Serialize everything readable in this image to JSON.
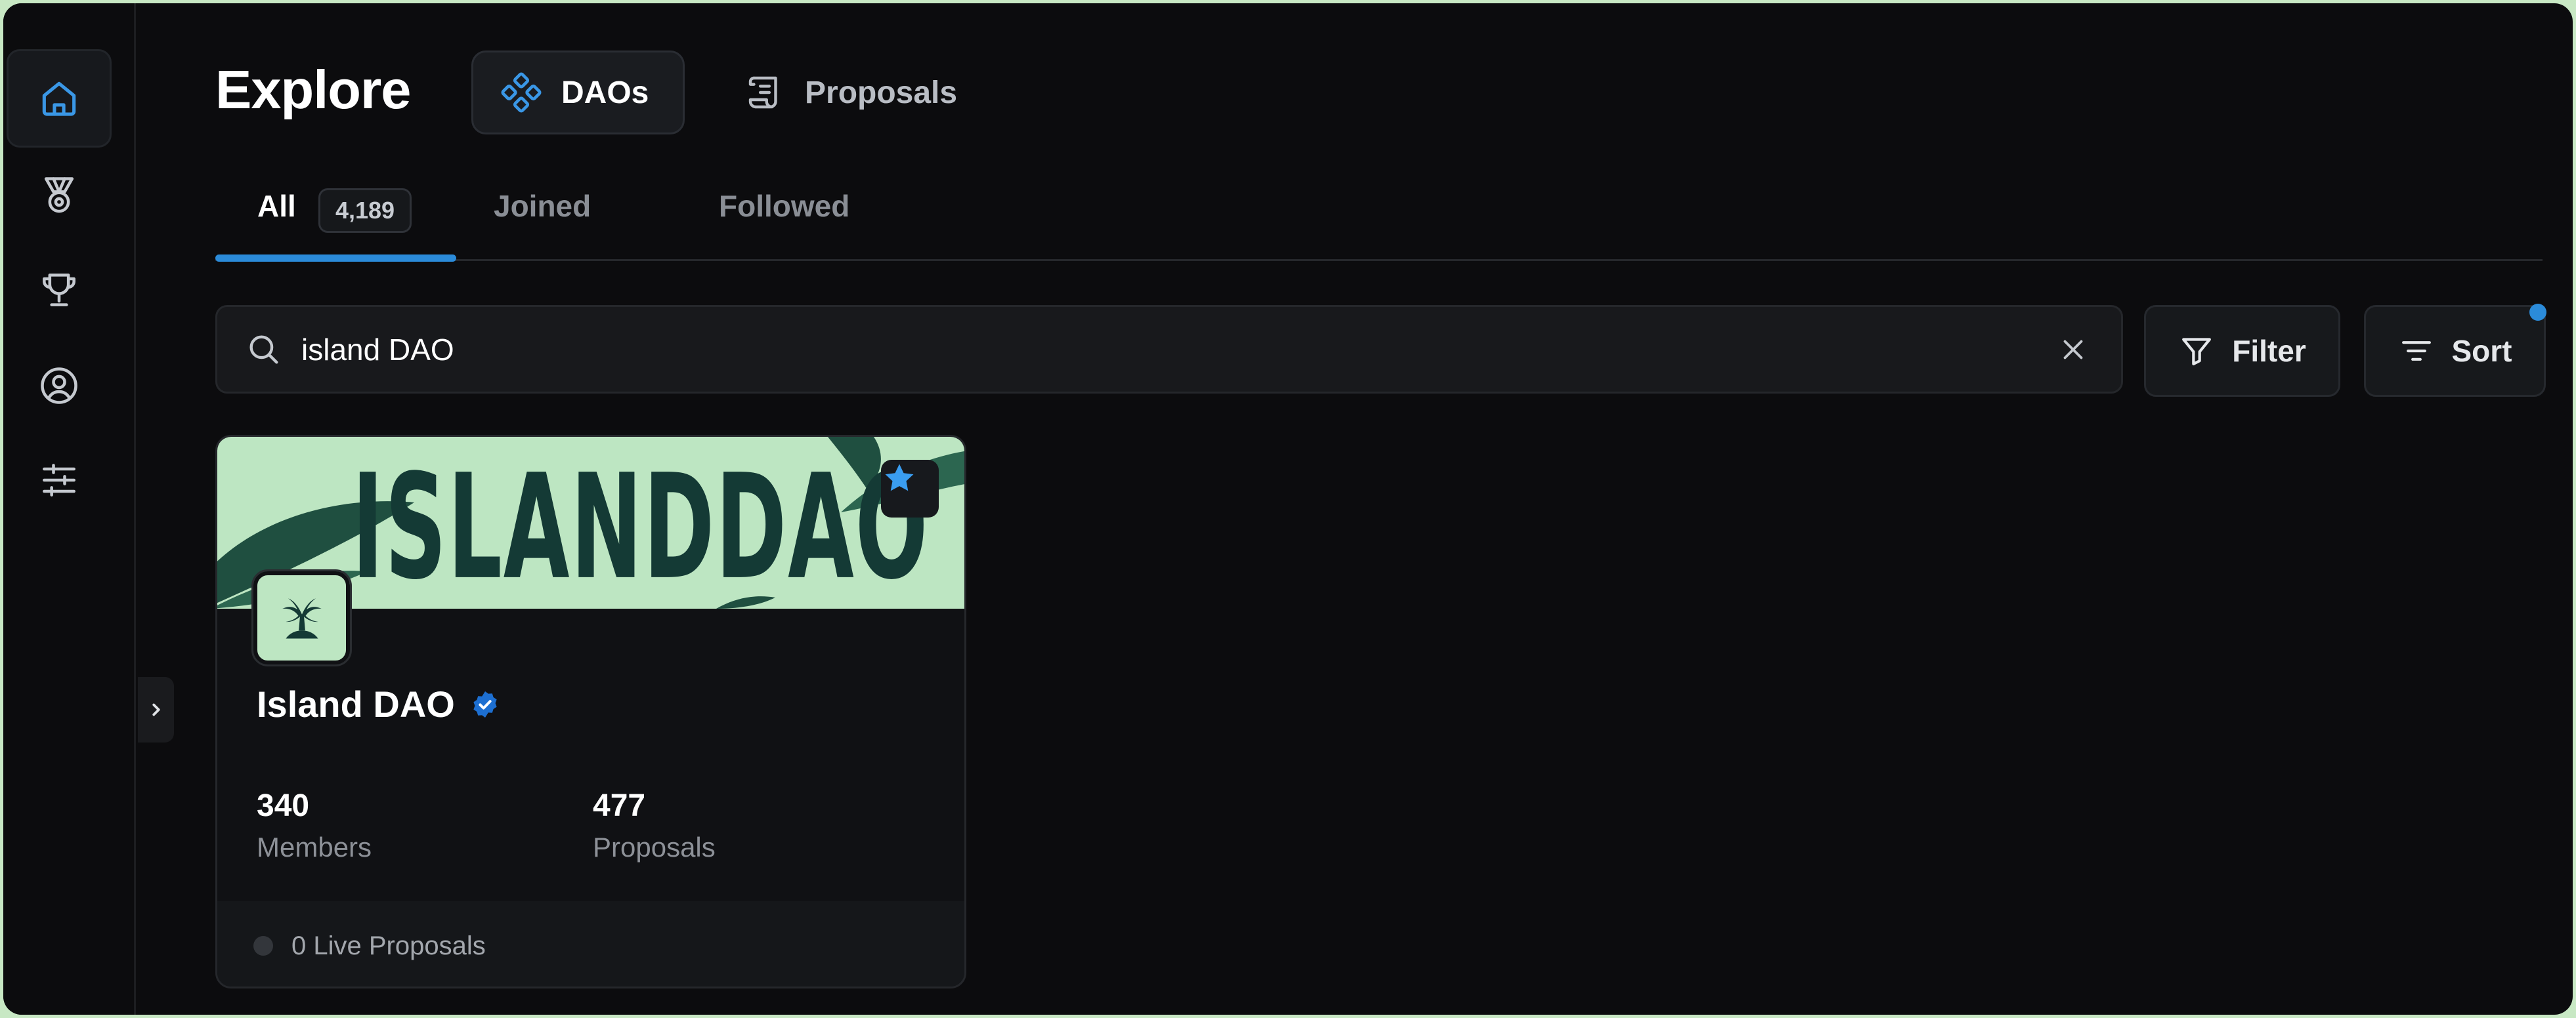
{
  "header": {
    "title": "Explore",
    "segments": [
      {
        "label": "DAOs",
        "icon": "daos-icon",
        "active": true
      },
      {
        "label": "Proposals",
        "icon": "scroll-icon",
        "active": false
      }
    ]
  },
  "tabs": {
    "all_label": "All",
    "all_count": "4,189",
    "joined_label": "Joined",
    "followed_label": "Followed",
    "active": "All"
  },
  "search": {
    "value": "island DAO",
    "placeholder": ""
  },
  "toolbar": {
    "filter_label": "Filter",
    "sort_label": "Sort"
  },
  "sidebar": {
    "items": [
      {
        "icon": "home-icon",
        "active": true
      },
      {
        "icon": "medal-icon",
        "active": false
      },
      {
        "icon": "trophy-icon",
        "active": false
      },
      {
        "icon": "user-circle-icon",
        "active": false
      },
      {
        "icon": "sliders-icon",
        "active": false
      }
    ]
  },
  "card": {
    "banner_text": "ISLANDDAO",
    "name": "Island DAO",
    "verified": true,
    "members_value": "340",
    "members_label": "Members",
    "proposals_value": "477",
    "proposals_label": "Proposals",
    "live_proposals": "0 Live Proposals"
  },
  "colors": {
    "accent": "#2b8bd9",
    "background": "#0c0c0e",
    "banner": "#bde6c2",
    "banner_text": "#143a35"
  }
}
